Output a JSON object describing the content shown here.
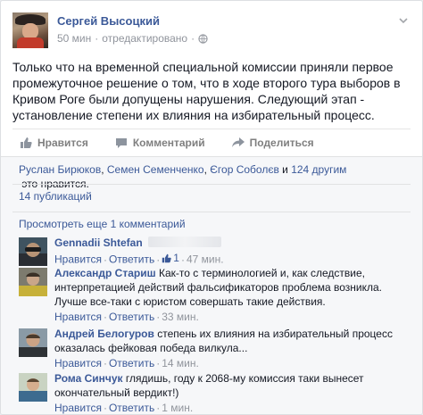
{
  "post": {
    "author": "Сергей Высоцкий",
    "time": "50 мин",
    "edited": "отредактировано",
    "text": "Только что на временной специальной комиссии приняли первое промежуточное решение о том, что в ходе второго тура выборов в Кривом Роге были допущены нарушения. Следующий этап - установление степени их влияния на избирательный процесс."
  },
  "actions": {
    "like": "Нравится",
    "comment": "Комментарий",
    "share": "Поделиться"
  },
  "likes": {
    "names": [
      "Руслан Бирюков",
      "Семен Семенченко",
      "Єгор Соболєв"
    ],
    "separator": ", ",
    "and": " и ",
    "others": "124 другим",
    "suffix": " это нравится."
  },
  "shares": "14 публикаций",
  "more_comments": "Просмотреть еще 1 комментарий",
  "comment_labels": {
    "like": "Нравится",
    "reply": "Ответить"
  },
  "comments": [
    {
      "name": "Gennadii Shtefan",
      "text": "",
      "likes": "1",
      "time": "47 мин."
    },
    {
      "name": "Александр Стариш",
      "text": "Как-то с терминологией и, как следствие, интерпретацией действий фальсификаторов проблема возникла. Лучше все-таки с юристом совершать такие действия.",
      "time": "33 мин."
    },
    {
      "name": "Андрей Белогуров",
      "text": "степень их влияния на избирательный процесс оказалась фейковая победа вилкула...",
      "time": "14 мин."
    },
    {
      "name": "Рома Синчук",
      "text": "глядишь, году к 2068-му комиссия таки вынесет окончательный вердикт!)",
      "time": "1 мин."
    }
  ],
  "icons": {
    "globe": "globe-icon",
    "chevron": "chevron-down-icon",
    "like": "thumbs-up-icon",
    "comment": "speech-bubble-icon",
    "share": "share-arrow-icon"
  },
  "colors": {
    "link": "#3b5998",
    "meta": "#90949c",
    "feedback_bg": "#f6f7f9"
  }
}
